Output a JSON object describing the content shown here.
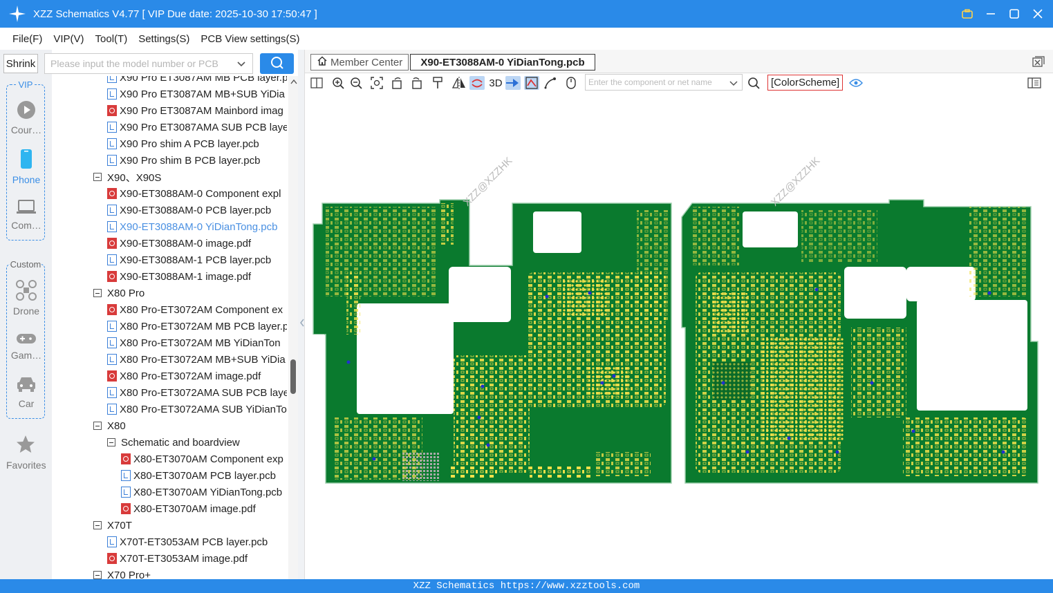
{
  "window": {
    "title": "XZZ Schematics V4.77 [ VIP Due date: 2025-10-30 17:50:47 ]"
  },
  "menu": [
    "File(F)",
    "VIP(V)",
    "Tool(T)",
    "Settings(S)",
    "PCB View settings(S)"
  ],
  "sidebar": {
    "shrink_label": "Shrink",
    "vip_group_title": "VIP",
    "custom_group_title": "Custom",
    "vip_items": [
      {
        "label": "Cour…",
        "icon": "play-icon"
      },
      {
        "label": "Phone",
        "icon": "phone-icon"
      },
      {
        "label": "Com…",
        "icon": "laptop-icon"
      }
    ],
    "custom_items": [
      {
        "label": "Drone",
        "icon": "drone-icon"
      },
      {
        "label": "Gam…",
        "icon": "gamepad-icon"
      },
      {
        "label": "Car",
        "icon": "car-icon"
      }
    ],
    "favorites_label": "Favorites"
  },
  "search": {
    "placeholder": "Please input the model number or PCB"
  },
  "tree": [
    {
      "type": "pcb",
      "level": 2,
      "label": "X90 Pro ET3087AM MB PCB layer.p"
    },
    {
      "type": "pcb",
      "level": 2,
      "label": "X90 Pro ET3087AM MB+SUB YiDia"
    },
    {
      "type": "pdf",
      "level": 2,
      "label": "X90 Pro ET3087AM Mainbord imag"
    },
    {
      "type": "pcb",
      "level": 2,
      "label": "X90 Pro ET3087AMA SUB PCB laye"
    },
    {
      "type": "pcb",
      "level": 2,
      "label": "X90 Pro shim A PCB layer.pcb"
    },
    {
      "type": "pcb",
      "level": 2,
      "label": "X90 Pro shim B PCB layer.pcb"
    },
    {
      "type": "folder",
      "level": 1,
      "label": "X90、X90S"
    },
    {
      "type": "pdf",
      "level": 2,
      "label": "X90-ET3088AM-0 Component expl"
    },
    {
      "type": "pcb",
      "level": 2,
      "label": "X90-ET3088AM-0 PCB layer.pcb"
    },
    {
      "type": "pcb",
      "level": 2,
      "label": "X90-ET3088AM-0 YiDianTong.pcb",
      "selected": true
    },
    {
      "type": "pdf",
      "level": 2,
      "label": "X90-ET3088AM-0 image.pdf"
    },
    {
      "type": "pcb",
      "level": 2,
      "label": "X90-ET3088AM-1 PCB layer.pcb"
    },
    {
      "type": "pdf",
      "level": 2,
      "label": "X90-ET3088AM-1 image.pdf"
    },
    {
      "type": "folder",
      "level": 1,
      "label": "X80 Pro"
    },
    {
      "type": "pdf",
      "level": 2,
      "label": "X80 Pro-ET3072AM Component ex"
    },
    {
      "type": "pcb",
      "level": 2,
      "label": "X80 Pro-ET3072AM MB PCB layer.p"
    },
    {
      "type": "pcb",
      "level": 2,
      "label": "X80 Pro-ET3072AM MB YiDianTon"
    },
    {
      "type": "pcb",
      "level": 2,
      "label": "X80 Pro-ET3072AM MB+SUB YiDia"
    },
    {
      "type": "pdf",
      "level": 2,
      "label": "X80 Pro-ET3072AM image.pdf"
    },
    {
      "type": "pcb",
      "level": 2,
      "label": "X80 Pro-ET3072AMA SUB PCB laye"
    },
    {
      "type": "pcb",
      "level": 2,
      "label": "X80 Pro-ET3072AMA SUB YiDianTo"
    },
    {
      "type": "folder",
      "level": 1,
      "label": "X80"
    },
    {
      "type": "folder",
      "level": 2,
      "label": "Schematic and boardview"
    },
    {
      "type": "pdf",
      "level": 3,
      "label": "X80-ET3070AM Component exp"
    },
    {
      "type": "pcb",
      "level": 3,
      "label": "X80-ET3070AM PCB layer.pcb"
    },
    {
      "type": "pcb",
      "level": 3,
      "label": "X80-ET3070AM YiDianTong.pcb"
    },
    {
      "type": "pdf",
      "level": 3,
      "label": "X80-ET3070AM image.pdf"
    },
    {
      "type": "folder",
      "level": 1,
      "label": "X70T"
    },
    {
      "type": "pcb",
      "level": 2,
      "label": "X70T-ET3053AM PCB layer.pcb"
    },
    {
      "type": "pdf",
      "level": 2,
      "label": "X70T-ET3053AM image.pdf"
    },
    {
      "type": "folder",
      "level": 1,
      "label": "X70 Pro+"
    }
  ],
  "tabs": {
    "member_center": "Member Center",
    "active_file": "X90-ET3088AM-0 YiDianTong.pcb"
  },
  "toolbar": {
    "three_d_label": "3D",
    "net_search_placeholder": "Enter the component or net name",
    "color_scheme_label": "[ColorScheme]"
  },
  "canvas": {
    "watermark": "XZZ@XZZHK"
  },
  "status": {
    "text": "XZZ Schematics https://www.xzztools.com"
  },
  "colors": {
    "accent": "#2a8ae8",
    "pcb_green": "#0a7a2e",
    "pad_yellow": "#f2e04a",
    "via_blue": "#2030d0"
  }
}
